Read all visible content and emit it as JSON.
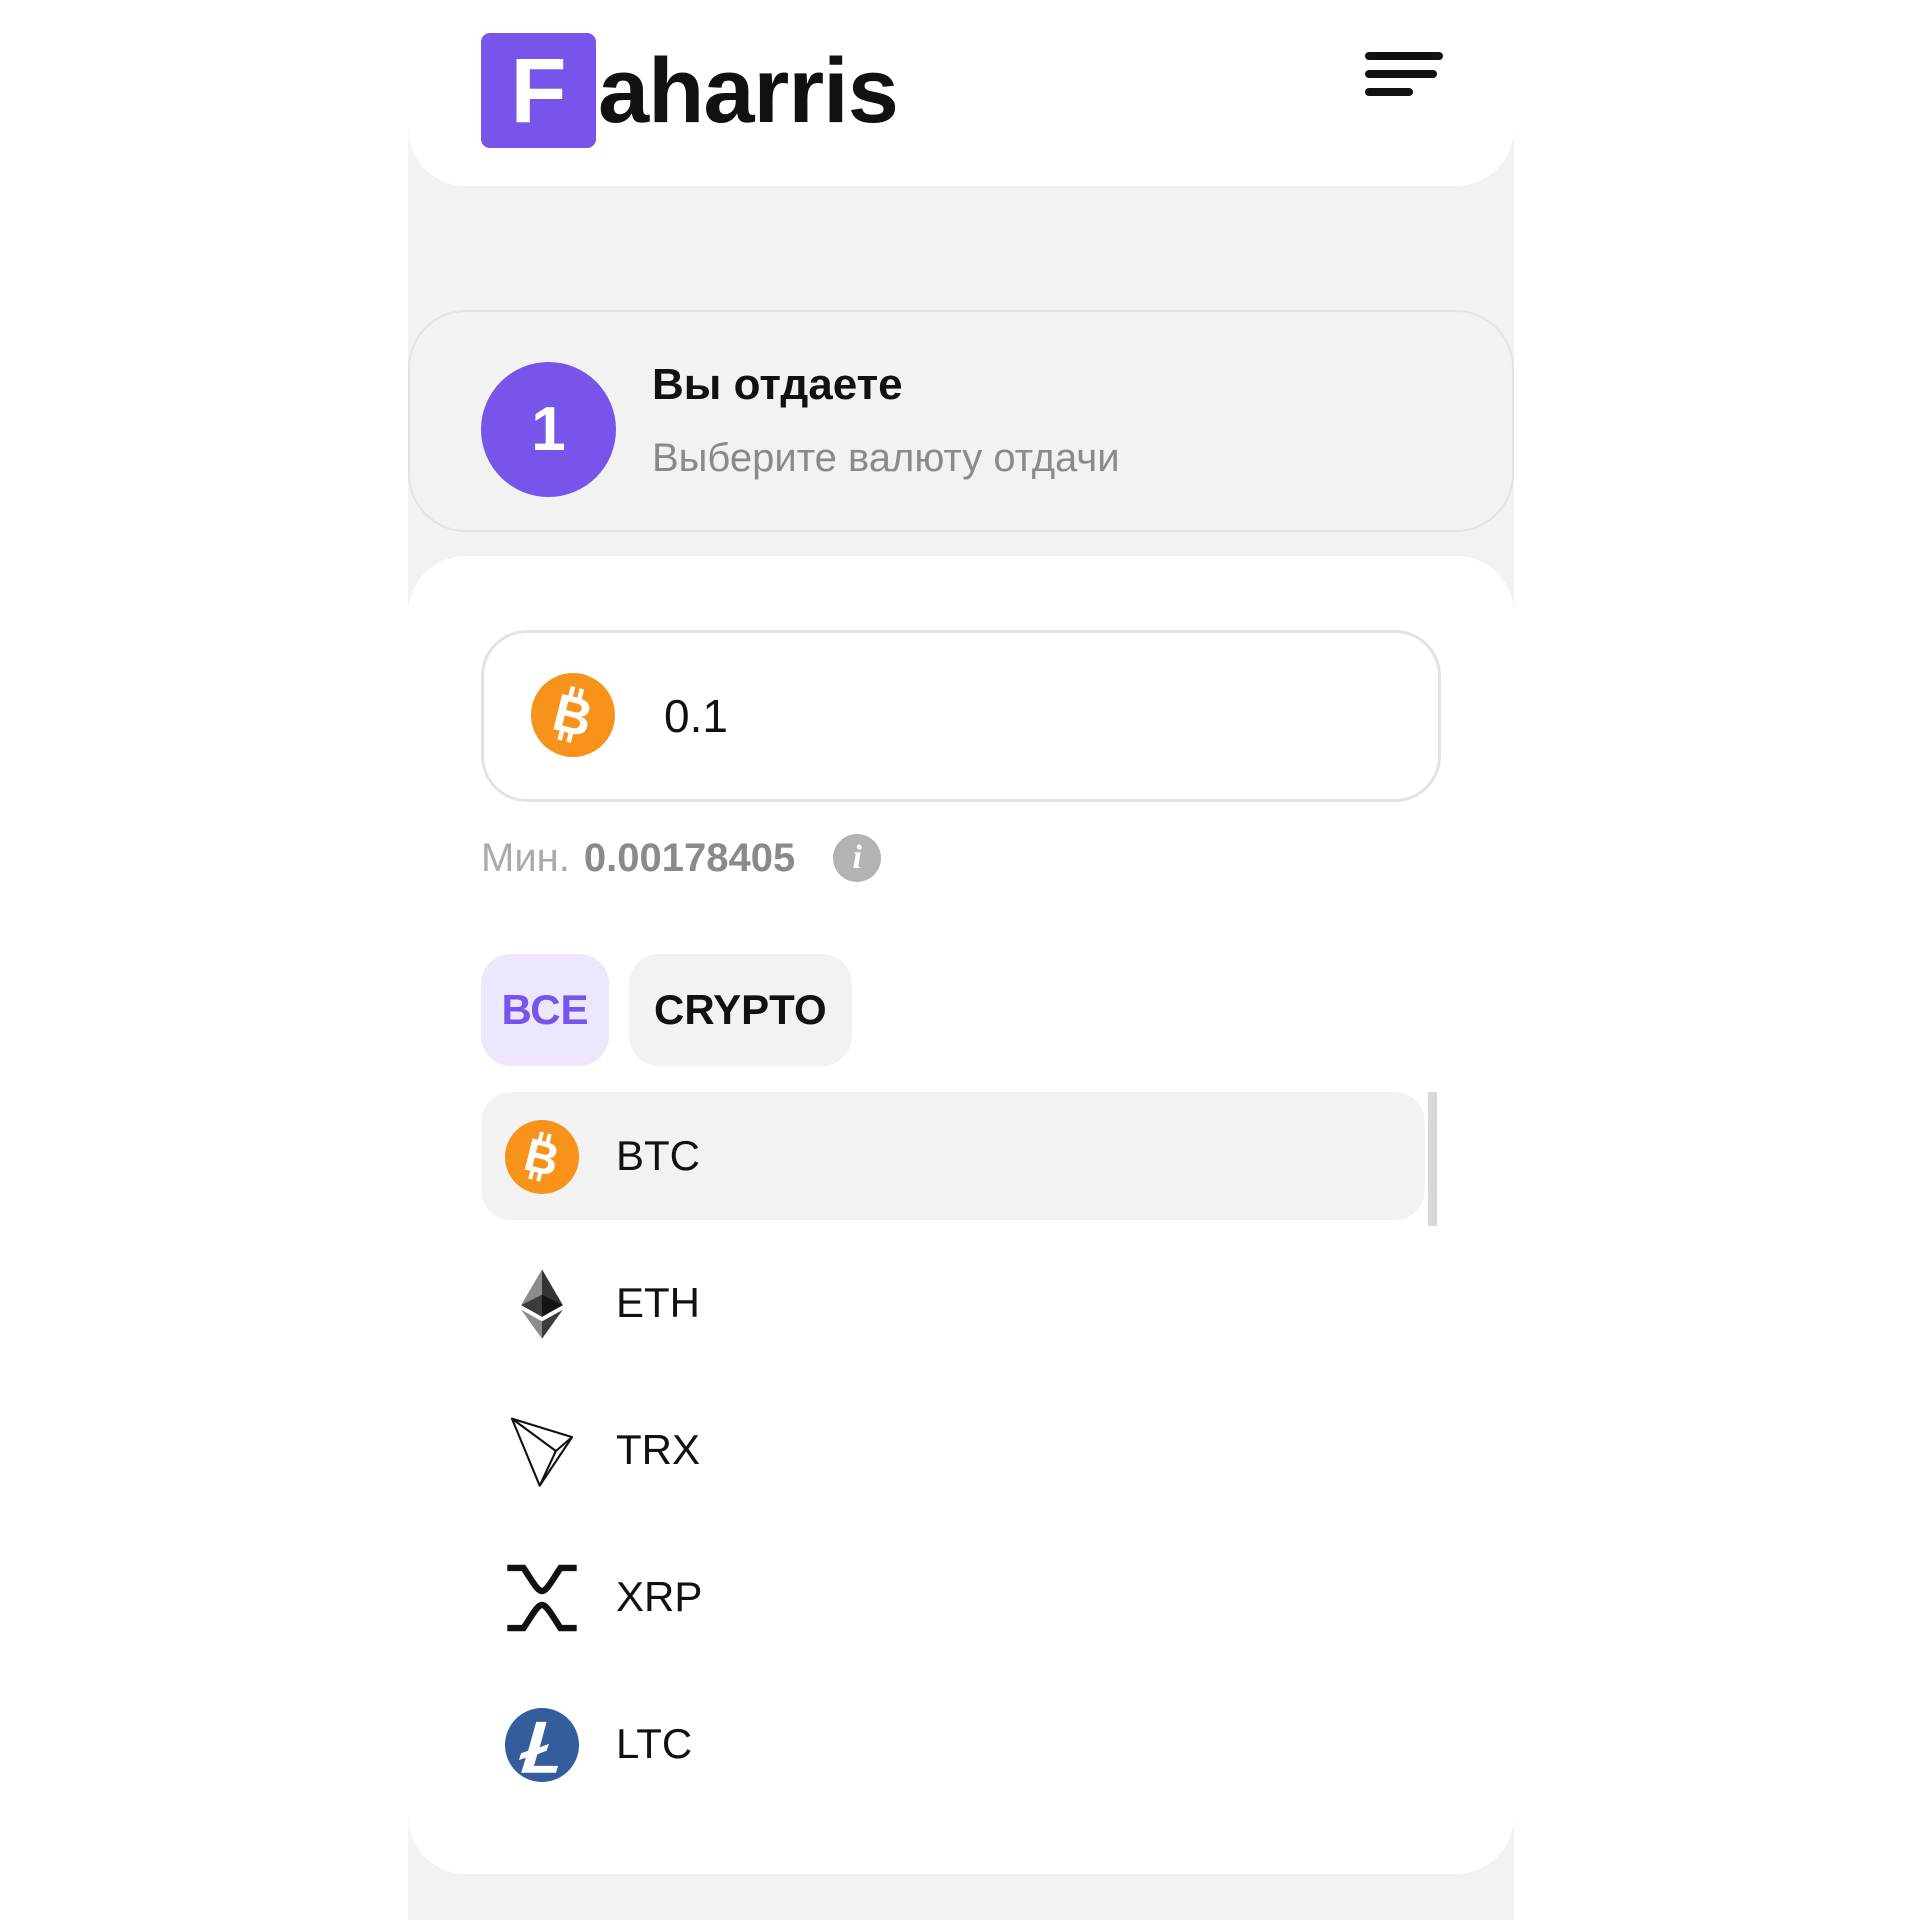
{
  "header": {
    "logo_letter": "F",
    "logo_rest": "aharris",
    "brand_color": "#7755ea"
  },
  "step": {
    "number": "1",
    "title": "Вы отдаете",
    "subtitle": "Выберите валюту отдачи"
  },
  "amount": {
    "value": "0.1",
    "currency_icon": "btc-icon"
  },
  "min": {
    "label": "Мин.",
    "value": "0.00178405"
  },
  "filters": [
    {
      "label": "ВСЕ",
      "active": true
    },
    {
      "label": "CRYPTO",
      "active": false
    }
  ],
  "currencies": [
    {
      "code": "BTC",
      "icon": "btc-icon",
      "selected": true
    },
    {
      "code": "ETH",
      "icon": "eth-icon",
      "selected": false
    },
    {
      "code": "TRX",
      "icon": "trx-icon",
      "selected": false
    },
    {
      "code": "XRP",
      "icon": "xrp-icon",
      "selected": false
    },
    {
      "code": "LTC",
      "icon": "ltc-icon",
      "selected": false
    }
  ],
  "colors": {
    "btc": "#f7931a",
    "ltc": "#345d9d",
    "accent": "#7755ea"
  }
}
